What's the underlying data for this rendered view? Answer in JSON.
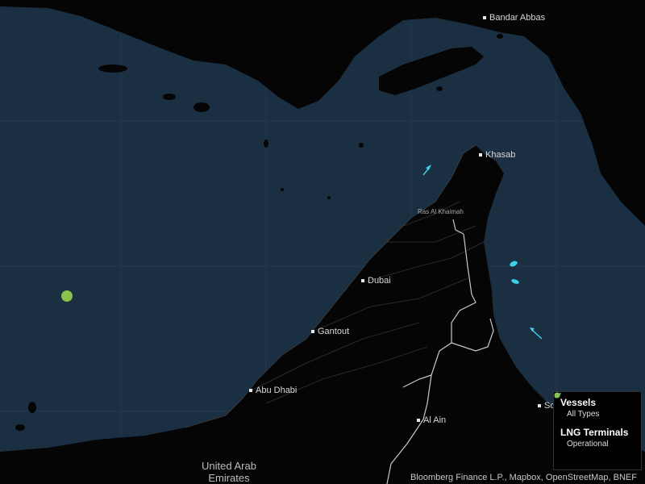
{
  "cities": [
    {
      "id": "bandar-abbas",
      "name": "Bandar Abbas"
    },
    {
      "id": "khasab",
      "name": "Khasab"
    },
    {
      "id": "dubai",
      "name": "Dubai"
    },
    {
      "id": "gantout",
      "name": "Gantout"
    },
    {
      "id": "abu-dhabi",
      "name": "Abu Dhabi"
    },
    {
      "id": "al-ain",
      "name": "Al Ain"
    },
    {
      "id": "sohar",
      "name": "So"
    }
  ],
  "regions": {
    "ras_al_khaimah": "Ras Al Khaimah",
    "uae": "United Arab\nEmirates"
  },
  "legend": {
    "vessels_title": "Vessels",
    "vessels_item": "All Types",
    "lng_title": "LNG Terminals",
    "lng_item": "Operational"
  },
  "attribution": "Bloomberg Finance L.P., Mapbox, OpenStreetMap, BNEF",
  "colors": {
    "sea": "#1b2f42",
    "land": "#050505",
    "vessel": "#3fd0e8",
    "lng_operational": "#8bc34a",
    "border": "#c9c9c9"
  }
}
